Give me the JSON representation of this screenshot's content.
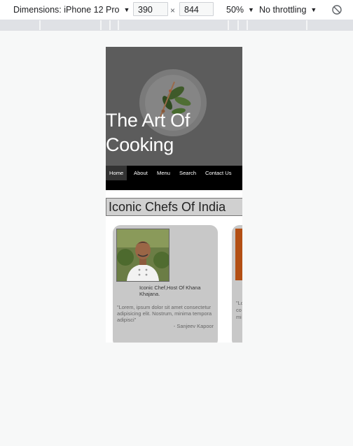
{
  "devtools": {
    "dimensions_label": "Dimensions: iPhone 12 Pro",
    "width_value": "390",
    "height_value": "844",
    "times_sign": "×",
    "zoom_label": "50%",
    "throttle_label": "No throttling"
  },
  "site": {
    "hero_title": "The Art Of Cooking",
    "nav": [
      "Home",
      "About",
      "Menu",
      "Search",
      "Contact Us"
    ],
    "section_title": "Iconic Chefs Of India",
    "cards": [
      {
        "role": "Iconic Chef,Host Of Khana Khajana.",
        "quote": "\"Lorem, ipsum dolor sit amet consectetur adipisicing elit. Nostrum, minima tempora adipisci\"",
        "author": "- Sanjeev Kapoor"
      },
      {
        "quote_fragment": "\"Lo\nco\nmi"
      }
    ]
  },
  "colors": {
    "nav_bg": "#000000",
    "nav_active": "#333333",
    "card_bg": "#c8c8c8",
    "section_bg": "#d0d0d0"
  }
}
